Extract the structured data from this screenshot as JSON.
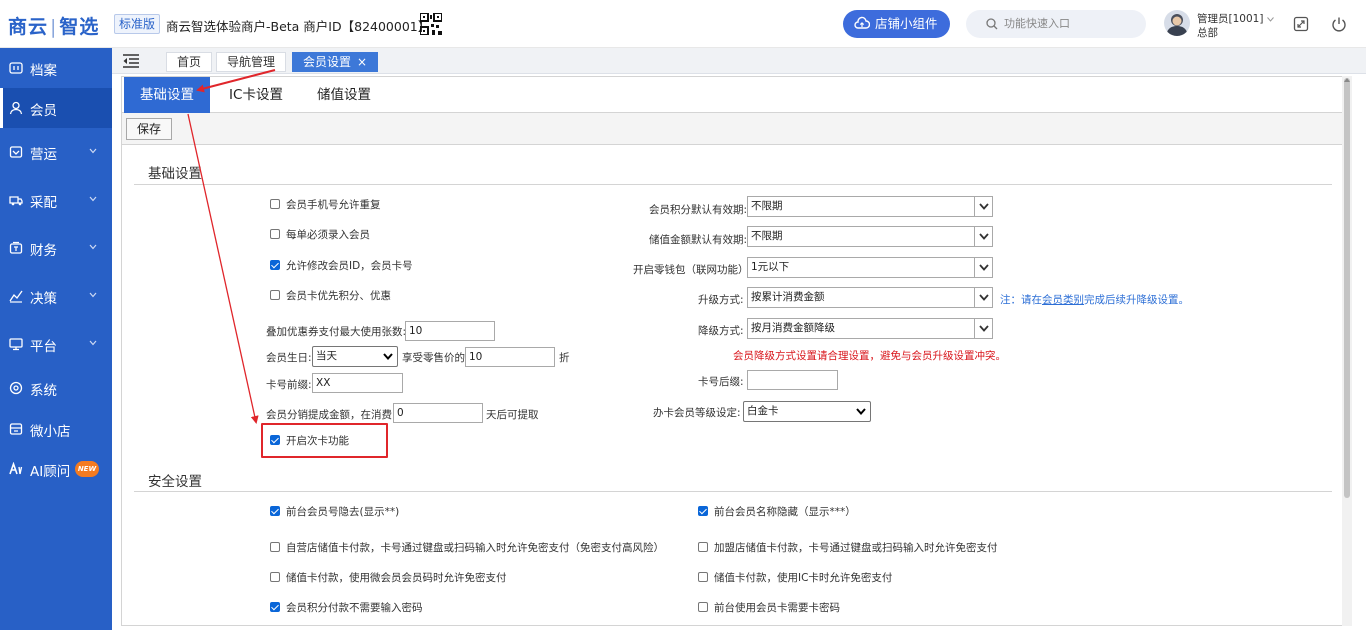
{
  "header": {
    "logo_main": "商云",
    "logo_sep": "|",
    "logo_sub": "智选",
    "edition": "标准版",
    "merchant": "商云智选体验商户-Beta  商户ID【82400001】",
    "widget_label": "店铺小组件",
    "search_placeholder": "功能快速入口",
    "user_name": "管理员[1001]",
    "user_org": "总部"
  },
  "sidebar": {
    "items": [
      {
        "label": "档案",
        "icon": "grid-icon"
      },
      {
        "label": "会员",
        "icon": "user-icon"
      },
      {
        "label": "营运",
        "icon": "shop-icon"
      },
      {
        "label": "采配",
        "icon": "truck-icon"
      },
      {
        "label": "财务",
        "icon": "wallet-icon"
      },
      {
        "label": "决策",
        "icon": "chart-icon"
      },
      {
        "label": "平台",
        "icon": "monitor-icon"
      },
      {
        "label": "系统",
        "icon": "settings-icon"
      },
      {
        "label": "微小店",
        "icon": "store-icon"
      },
      {
        "label": "AI顾问",
        "icon": "ai-icon"
      }
    ],
    "new_badge": "NEW"
  },
  "nav_tabs": [
    {
      "label": "首页"
    },
    {
      "label": "导航管理"
    },
    {
      "label": "会员设置",
      "close": "×"
    }
  ],
  "sub_tabs": [
    {
      "label": "基础设置"
    },
    {
      "label": "IC卡设置"
    },
    {
      "label": "储值设置"
    }
  ],
  "toolbar": {
    "save_label": "保存"
  },
  "basic": {
    "title": "基础设置",
    "left_checkboxes": [
      {
        "label": "会员手机号允许重复",
        "checked": false
      },
      {
        "label": "每单必须录入会员",
        "checked": false
      },
      {
        "label": "允许修改会员ID，会员卡号",
        "checked": true
      },
      {
        "label": "会员卡优先积分、优惠",
        "checked": false
      }
    ],
    "coupon_limit_label": "叠加优惠券支付最大使用张数:",
    "coupon_limit_value": "10",
    "birthday_label": "会员生日:",
    "birthday_value": "当天",
    "discount_label": "享受零售价的",
    "discount_value": "10",
    "discount_unit": "折",
    "card_prefix_label": "卡号前缀:",
    "card_prefix_value": "XX",
    "distribution_label": "会员分销提成金额，在消费",
    "distribution_value": "0",
    "distribution_suffix": "天后可提取",
    "times_card_label": "开启次卡功能",
    "times_card_checked": true,
    "points_validity_label": "会员积分默认有效期:",
    "points_validity_value": "不限期",
    "stored_validity_label": "储值金额默认有效期:",
    "stored_validity_value": "不限期",
    "change_wallet_label": "开启零钱包（联网功能）",
    "change_wallet_value": "1元以下",
    "upgrade_label": "升级方式:",
    "upgrade_value": "按累计消费金额",
    "upgrade_note_prefix": "注：请在",
    "upgrade_note_link": "会员类别",
    "upgrade_note_suffix": "完成后续升降级设置。",
    "downgrade_label": "降级方式:",
    "downgrade_value": "按月消费金额降级",
    "downgrade_warning": "会员降级方式设置请合理设置，避免与会员升级设置冲突。",
    "card_suffix_label": "卡号后缀:",
    "card_suffix_value": "",
    "card_level_label": "办卡会员等级设定:",
    "card_level_value": "白金卡"
  },
  "security": {
    "title": "安全设置",
    "left_checkboxes": [
      {
        "label": "前台会员号隐去(显示**)",
        "checked": true
      },
      {
        "label": "自营店储值卡付款，卡号通过键盘或扫码输入时允许免密支付（免密支付高风险）",
        "checked": false
      },
      {
        "label": "储值卡付款，使用微会员会员码时允许免密支付",
        "checked": false
      },
      {
        "label": "会员积分付款不需要输入密码",
        "checked": true
      }
    ],
    "right_checkboxes": [
      {
        "label": "前台会员名称隐藏（显示***）",
        "checked": true
      },
      {
        "label": "加盟店储值卡付款，卡号通过键盘或扫码输入时允许免密支付",
        "checked": false
      },
      {
        "label": "储值卡付款，使用IC卡时允许免密支付",
        "checked": false
      },
      {
        "label": "前台使用会员卡需要卡密码",
        "checked": false
      }
    ]
  },
  "colors": {
    "brand": "#2860c6",
    "active_tab": "#2f6ad3",
    "warning": "#d9161c",
    "annotation": "#e0262b"
  }
}
